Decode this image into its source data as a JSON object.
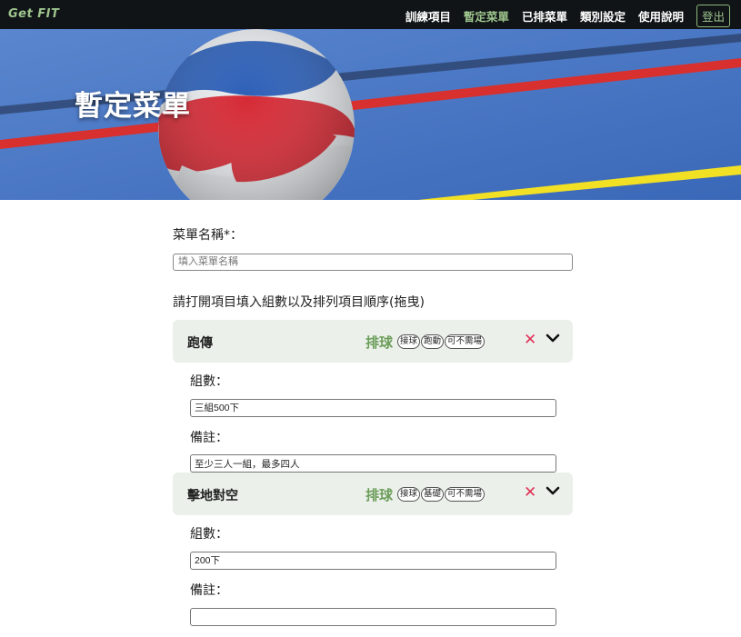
{
  "navbar": {
    "brand": "Get FIT",
    "links": [
      {
        "label": "訓練項目",
        "active": false
      },
      {
        "label": "暫定菜單",
        "active": true
      },
      {
        "label": "已排菜單",
        "active": false
      },
      {
        "label": "類別設定",
        "active": false
      },
      {
        "label": "使用說明",
        "active": false
      }
    ],
    "logout": "登出"
  },
  "banner": {
    "title": "暫定菜單"
  },
  "form": {
    "name_label": "菜單名稱*：",
    "name_placeholder": "填入菜單名稱",
    "name_value": "",
    "instruction": "請打開項目填入組數以及排列項目順序(拖曳)"
  },
  "items": [
    {
      "title": "跑傳",
      "category": "排球",
      "tags": [
        "接球",
        "跑動",
        "可不需場"
      ],
      "sets_label": "組數：",
      "sets_value": "三組500下",
      "notes_label": "備註：",
      "notes_value": "至少三人一組，最多四人"
    },
    {
      "title": "擊地對空",
      "category": "排球",
      "tags": [
        "接球",
        "基礎",
        "可不需場"
      ],
      "sets_label": "組數：",
      "sets_value": "200下",
      "notes_label": "備註：",
      "notes_value": ""
    }
  ],
  "colors": {
    "navbar_bg": "#101416",
    "accent_green": "#9ec48d",
    "category_green": "#6c9e5a",
    "remove_red": "#e03057",
    "card_bg": "#ebf0ea"
  },
  "icons": {
    "remove": "close-icon",
    "expand": "chevron-down-icon"
  }
}
